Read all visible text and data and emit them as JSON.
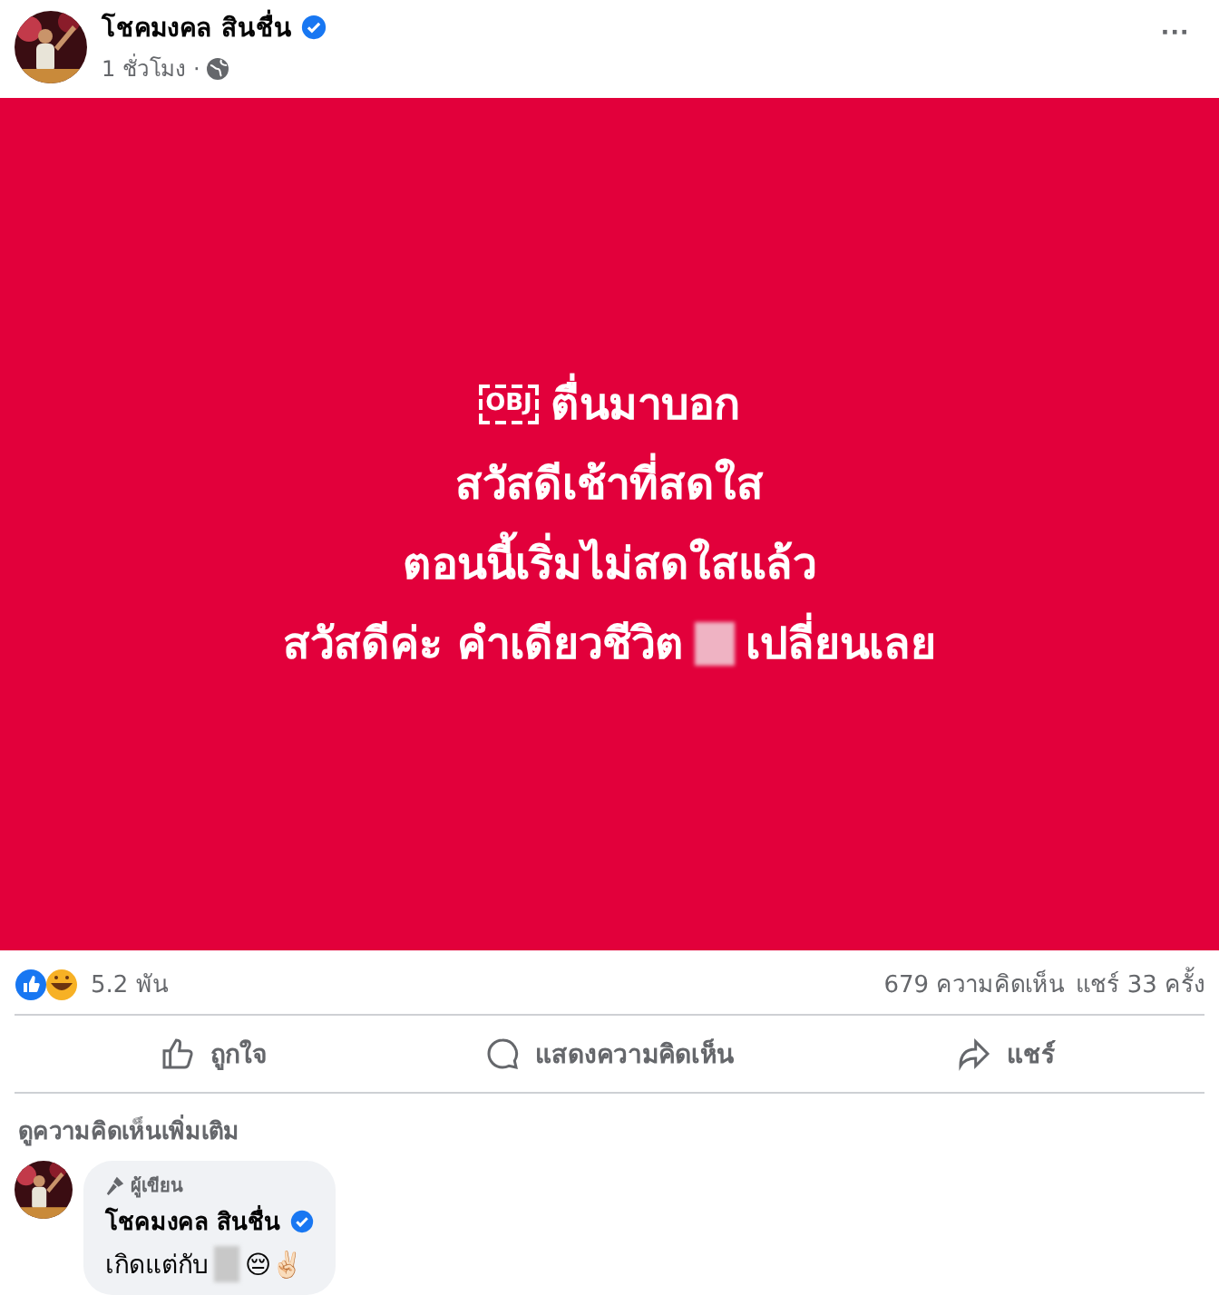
{
  "post": {
    "author": "โชคมงคล สินชื่น",
    "verified": true,
    "time": "1 ชั่วโมง",
    "separator": "·",
    "more": "···"
  },
  "card": {
    "lines": [
      {
        "parts": [
          {
            "kind": "obj",
            "text": "OBJ"
          },
          {
            "kind": "text",
            "text": "ตื่นมาบอก"
          }
        ]
      },
      {
        "parts": [
          {
            "kind": "text",
            "text": "สวัสดีเช้าที่สดใส"
          }
        ]
      },
      {
        "parts": [
          {
            "kind": "text",
            "text": "ตอนนี้เริ่มไม่สดใสแล้ว"
          }
        ]
      },
      {
        "parts": [
          {
            "kind": "text",
            "text": "สวัสดีค่ะ คำเดียวชีวิต"
          },
          {
            "kind": "blur"
          },
          {
            "kind": "text",
            "text": "เปลี่ยนเลย"
          }
        ]
      }
    ]
  },
  "stats": {
    "reactions": "5.2 พัน",
    "comments": "679 ความคิดเห็น",
    "shares": "แชร์ 33 ครั้ง"
  },
  "actions": [
    {
      "kind": "like",
      "label": "ถูกใจ"
    },
    {
      "kind": "comment",
      "label": "แสดงความคิดเห็น"
    },
    {
      "kind": "share",
      "label": "แชร์"
    }
  ],
  "more_comments": "ดูความคิดเห็นเพิ่มเติม",
  "comment": {
    "badge": "ผู้เขียน",
    "author": "โชคมงคล สินชื่น",
    "verified": true,
    "parts": [
      {
        "kind": "text",
        "text": "เกิดแต่กับ"
      },
      {
        "kind": "blur"
      },
      {
        "kind": "text",
        "text": "😔✌🏻"
      }
    ]
  }
}
